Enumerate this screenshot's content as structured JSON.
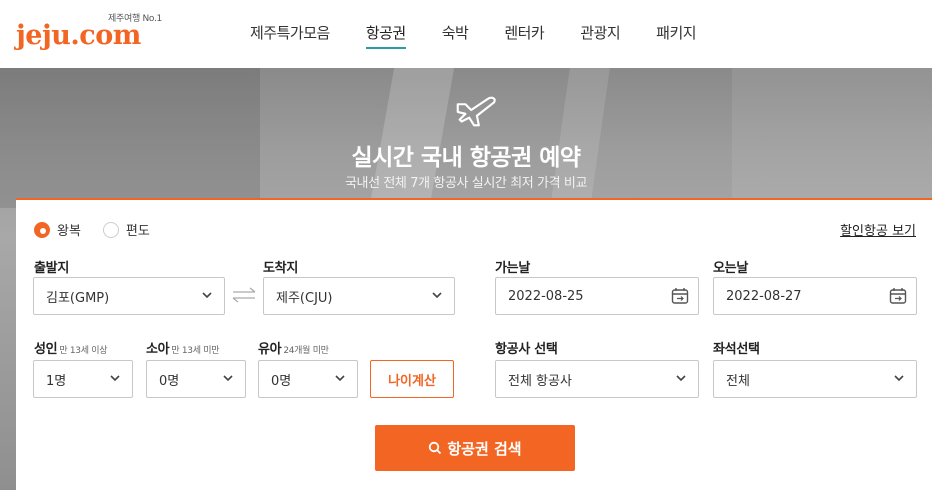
{
  "brand": {
    "tagline": "제주여행 No.1",
    "name_main": "jeju",
    "name_dot": ".",
    "name_suffix": "com",
    "accent_color": "#f26522",
    "nav_underline_color": "#2a9dab"
  },
  "nav": {
    "items": [
      {
        "label": "제주특가모음"
      },
      {
        "label": "항공권",
        "active": true
      },
      {
        "label": "숙박"
      },
      {
        "label": "렌터카"
      },
      {
        "label": "관광지"
      },
      {
        "label": "패키지"
      }
    ]
  },
  "hero": {
    "icon": "airplane-icon",
    "title": "실시간 국내 항공권 예약",
    "subtitle": "국내선 전체 7개 항공사 실시간 최저 가격 비교"
  },
  "search": {
    "trip_type": {
      "round_trip": "왕복",
      "one_way": "편도",
      "selected": "왕복"
    },
    "discount_link": "할인항공 보기",
    "departure": {
      "label": "출발지",
      "value": "김포(GMP)"
    },
    "arrival": {
      "label": "도착지",
      "value": "제주(CJU)"
    },
    "depart_date": {
      "label": "가는날",
      "value": "2022-08-25"
    },
    "return_date": {
      "label": "오는날",
      "value": "2022-08-27"
    },
    "adult": {
      "label": "성인",
      "hint": "만 13세 이상",
      "value": "1명"
    },
    "child": {
      "label": "소아",
      "hint": "만 13세 미만",
      "value": "0명"
    },
    "infant": {
      "label": "유아",
      "hint": "24개월 미만",
      "value": "0명"
    },
    "age_calc_button": "나이계산",
    "airline": {
      "label": "항공사 선택",
      "value": "전체 항공사"
    },
    "seat_class": {
      "label": "좌석선택",
      "value": "전체"
    },
    "search_button": "항공권 검색"
  }
}
